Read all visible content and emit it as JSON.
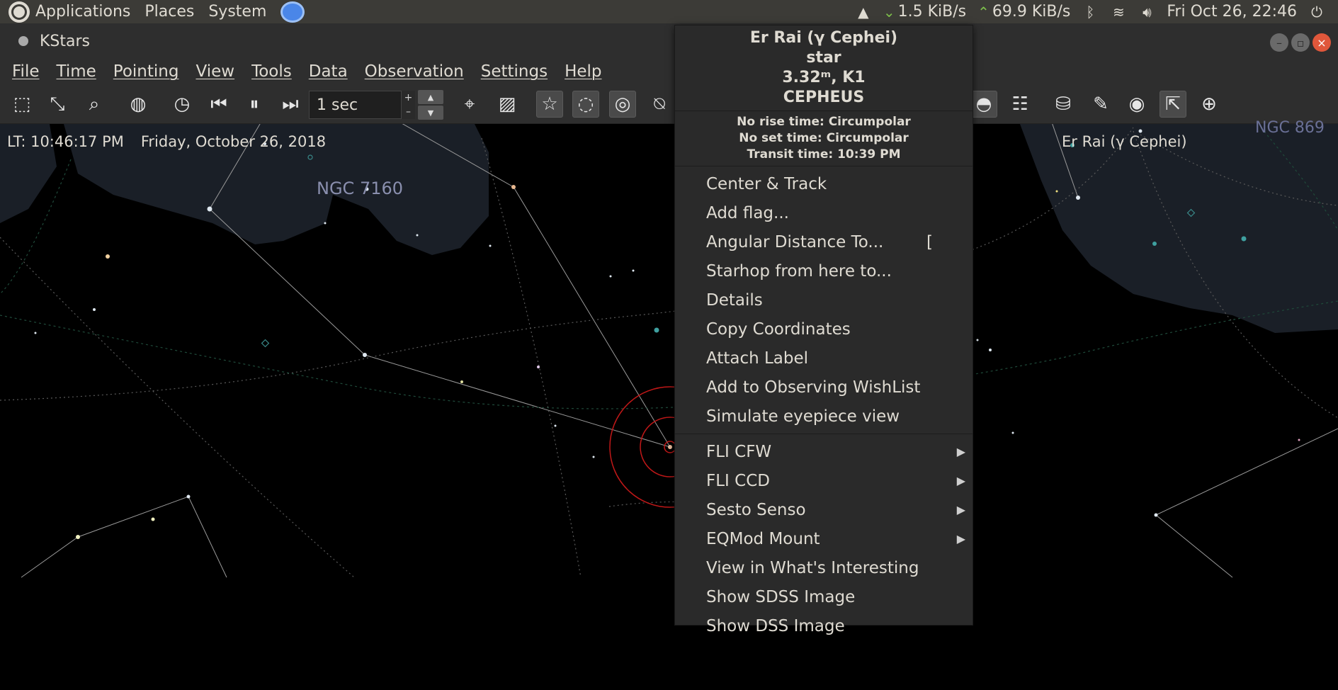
{
  "system_panel": {
    "menus": [
      "Applications",
      "Places",
      "System"
    ],
    "net_down": "1.5 KiB/s",
    "net_up": "69.9 KiB/s",
    "clock": "Fri Oct 26, 22:46"
  },
  "window": {
    "title": "KStars"
  },
  "menubar": {
    "items": [
      "File",
      "Time",
      "Pointing",
      "View",
      "Tools",
      "Data",
      "Observation",
      "Settings",
      "Help"
    ]
  },
  "toolbar": {
    "time_step_value": "1 sec"
  },
  "sky": {
    "local_time": "LT: 10:46:17 PM",
    "date": "Friday, October 26, 2018",
    "focus_object": "Er Rai (γ Cephei)",
    "labels": [
      "NGC 7160",
      "NGC 869"
    ],
    "colors": {
      "nebula": "#1a1f27",
      "constellation_lines": "#9a9a9a",
      "target_circle": "#c01818"
    }
  },
  "popup": {
    "object_name": "Er Rai (γ Cephei)",
    "object_type": "star",
    "magnitude_spectral": "3.32ᵐ, K1",
    "constellation": "CEPHEUS",
    "rise": "No rise time: Circumpolar",
    "set": "No set time: Circumpolar",
    "transit": "Transit time: 10:39 PM",
    "items": [
      {
        "label": "Center & Track",
        "shortcut": ""
      },
      {
        "label": "Add flag...",
        "shortcut": ""
      },
      {
        "label": "Angular Distance To...",
        "shortcut": "["
      },
      {
        "label": "Starhop from here to...",
        "shortcut": ""
      },
      {
        "label": "Details",
        "shortcut": ""
      },
      {
        "label": "Copy Coordinates",
        "shortcut": ""
      },
      {
        "label": "Attach Label",
        "shortcut": ""
      },
      {
        "label": "Add to Observing WishList",
        "shortcut": ""
      },
      {
        "label": "Simulate eyepiece view",
        "shortcut": ""
      }
    ],
    "device_items": [
      {
        "label": "FLI CFW"
      },
      {
        "label": "FLI CCD"
      },
      {
        "label": "Sesto Senso"
      },
      {
        "label": "EQMod Mount"
      }
    ],
    "extra_items": [
      {
        "label": "View in What's Interesting"
      },
      {
        "label": "Show SDSS Image"
      },
      {
        "label": "Show DSS Image"
      }
    ]
  }
}
